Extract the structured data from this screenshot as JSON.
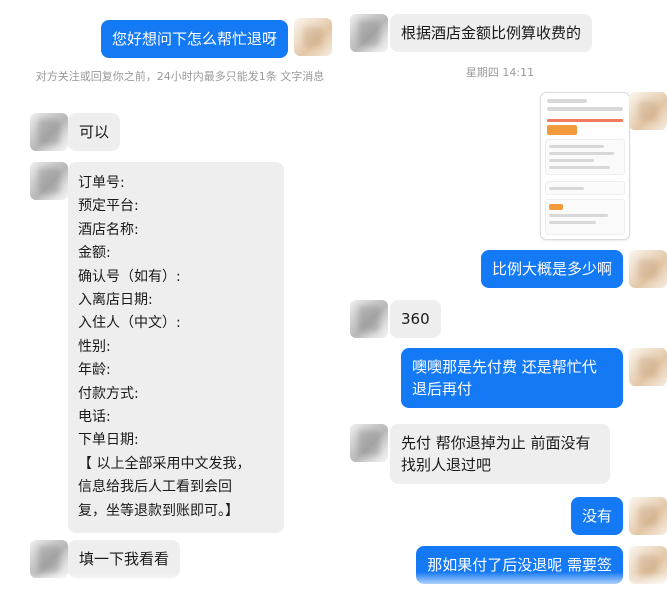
{
  "left_chat": {
    "msg_user_1": "您好想问下怎么帮忙退呀",
    "system_notice": "对方关注或回复你之前，24小时内最多只能发1条\n文字消息",
    "msg_agent_1": "可以",
    "order_form": "订单号:\n预定平台:\n酒店名称:\n金额:\n确认号（如有）:\n入离店日期:\n入住人（中文）:\n性别:\n年龄:\n付款方式:\n电话:\n下单日期:\n【 以上全部采用中文发我，\n信息给我后人工看到会回\n复，坐等退款到账即可。】",
    "msg_agent_2": "填一下我看看"
  },
  "right_chat": {
    "msg_agent_1": "根据酒店金额比例算收费的",
    "timestamp": "星期四 14:11",
    "screenshot_image": "order-screenshot",
    "msg_user_1": "比例大概是多少啊",
    "msg_agent_2": "360",
    "msg_user_2": "噢噢那是先付费 还是帮忙代\n退后再付",
    "msg_agent_3": "先付 帮你退掉为止 前面没有\n找别人退过吧",
    "msg_user_3": "没有",
    "msg_user_4": "那如果付了后没退呢 需要签"
  },
  "colors": {
    "outgoing_bubble": "#1479f4",
    "incoming_bubble": "#eeeeee",
    "system_text": "#9a9a9a"
  }
}
